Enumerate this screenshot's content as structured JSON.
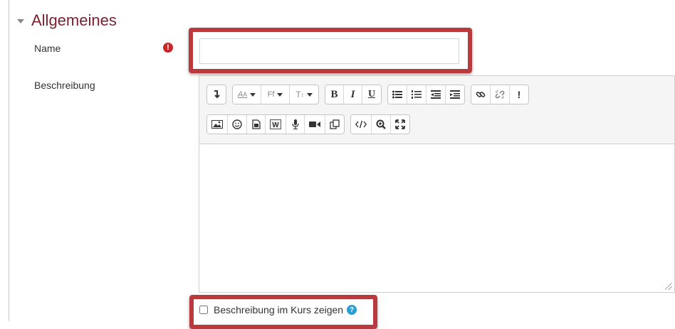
{
  "section": {
    "title": "Allgemeines"
  },
  "fields": {
    "name_label": "Name",
    "name_value": "",
    "description_label": "Beschreibung",
    "show_description_label": "Beschreibung im Kurs zeigen"
  },
  "toolbar": {
    "row1": [
      "toggle",
      "font-color",
      "font-family",
      "font-size",
      "bold",
      "italic",
      "underline",
      "unordered-list",
      "ordered-list",
      "outdent",
      "indent",
      "link",
      "unlink",
      "accessibility"
    ],
    "row2": [
      "image",
      "emoticon",
      "media",
      "word-import",
      "record-audio",
      "record-video",
      "manage-files",
      "html",
      "screenreader",
      "fullscreen"
    ],
    "labels": {
      "font_color": "A",
      "font_family": "Ff",
      "font_size": "T",
      "bold": "B",
      "italic": "I",
      "underline": "U",
      "accessibility": "!"
    }
  },
  "icons": {
    "required": "exclamation-circle-icon",
    "help": "question-circle-icon",
    "collapse": "caret-down-icon"
  },
  "colors": {
    "section_title": "#7b1f2e",
    "highlight": "#b83a3e",
    "required": "#c62828",
    "help": "#2a9fd6"
  }
}
